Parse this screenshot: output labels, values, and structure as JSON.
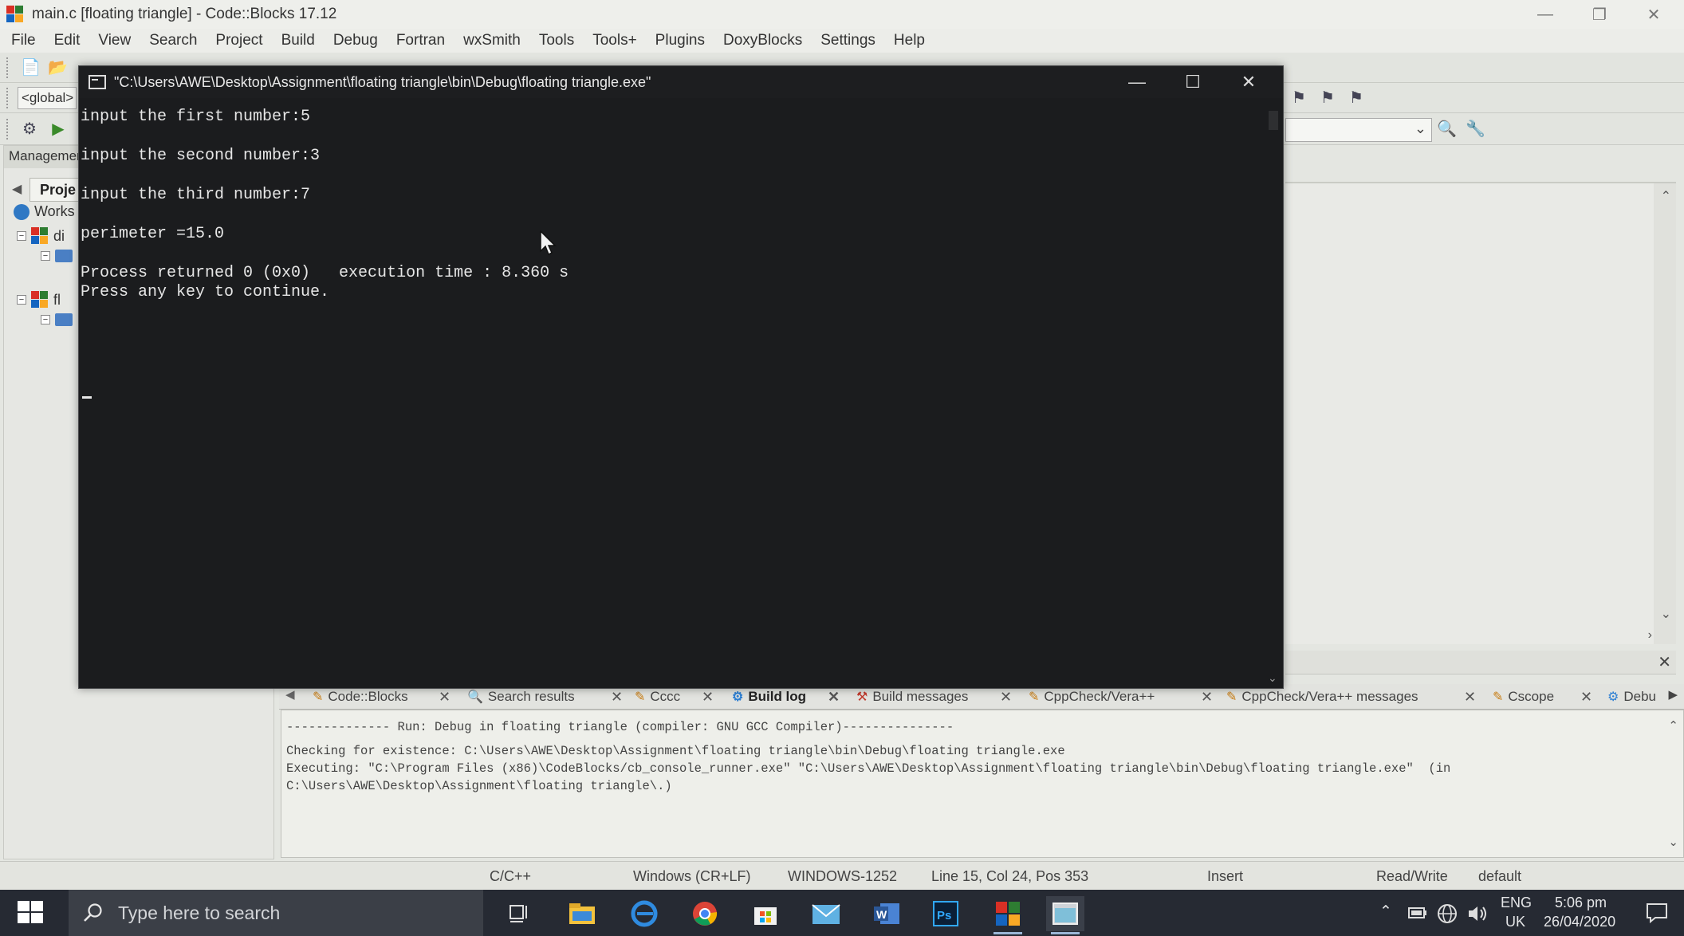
{
  "app": {
    "title": "main.c [floating triangle] - Code::Blocks 17.12",
    "menu": [
      "File",
      "Edit",
      "View",
      "Search",
      "Project",
      "Build",
      "Debug",
      "Fortran",
      "wxSmith",
      "Tools",
      "Tools+",
      "Plugins",
      "DoxyBlocks",
      "Settings",
      "Help"
    ],
    "scope_combo": "<global>",
    "management_header": "Managemen",
    "management_tab": "Proje",
    "tree": {
      "workspace": "Works",
      "project1": "di",
      "project2": "fl"
    }
  },
  "console": {
    "title": "\"C:\\Users\\AWE\\Desktop\\Assignment\\floating triangle\\bin\\Debug\\floating triangle.exe\"",
    "lines": [
      "input the first number:5",
      "input the second number:3",
      "input the third number:7",
      "perimeter =15.0",
      "Process returned 0 (0x0)   execution time : 8.360 s",
      "Press any key to continue."
    ]
  },
  "logs": {
    "tabs": [
      "Code::Blocks",
      "Search results",
      "Cccc",
      "Build log",
      "Build messages",
      "CppCheck/Vera++",
      "CppCheck/Vera++ messages",
      "Cscope",
      "Debu"
    ],
    "active_tab": "Build log",
    "lines": [
      "-------------- Run: Debug in floating triangle (compiler: GNU GCC Compiler)---------------",
      "Checking for existence: C:\\Users\\AWE\\Desktop\\Assignment\\floating triangle\\bin\\Debug\\floating triangle.exe",
      "Executing: \"C:\\Program Files (x86)\\CodeBlocks/cb_console_runner.exe\" \"C:\\Users\\AWE\\Desktop\\Assignment\\floating triangle\\bin\\Debug\\floating triangle.exe\"  (in",
      "C:\\Users\\AWE\\Desktop\\Assignment\\floating triangle\\.)"
    ]
  },
  "status": {
    "language": "C/C++",
    "line_endings": "Windows (CR+LF)",
    "encoding": "WINDOWS-1252",
    "position": "Line 15, Col 24, Pos 353",
    "mode": "Insert",
    "access": "Read/Write",
    "profile": "default"
  },
  "taskbar": {
    "search_placeholder": "Type here to search",
    "lang_top": "ENG",
    "lang_bottom": "UK",
    "time": "5:06 pm",
    "date": "26/04/2020"
  },
  "colors": {
    "console_bg": "#1b1c1e",
    "console_text": "#e6e6e6",
    "taskbar_bg": "#262a33",
    "ide_bg": "#e4e6e1"
  },
  "icons": [
    "codeblocks-icon",
    "search-icon",
    "start-icon",
    "task-view-icon",
    "file-explorer-icon",
    "edge-icon",
    "chrome-icon",
    "store-icon",
    "mail-icon",
    "word-icon",
    "photoshop-icon",
    "codeblocks-taskbar-icon",
    "console-taskbar-icon",
    "network-icon",
    "volume-icon",
    "notification-icon"
  ]
}
